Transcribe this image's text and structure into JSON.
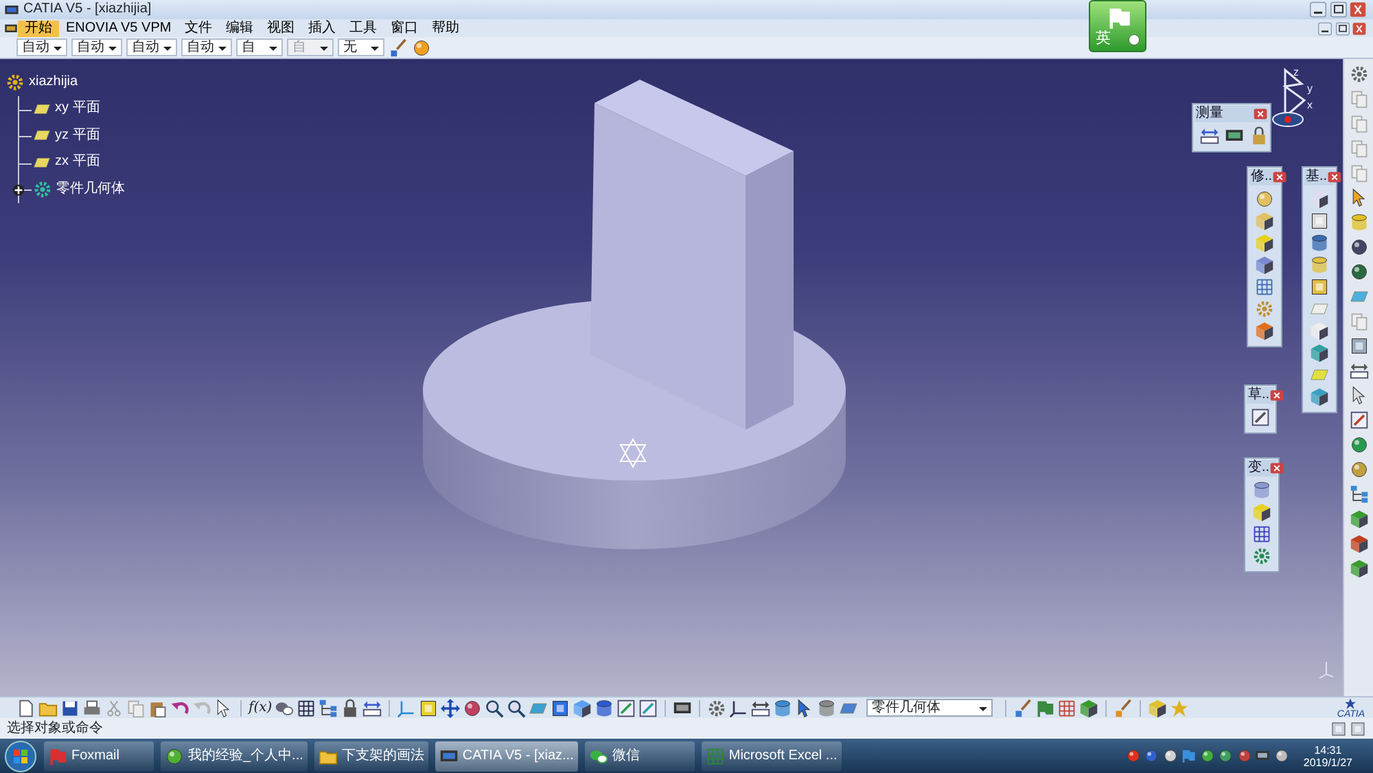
{
  "window": {
    "title": "CATIA V5 - [xiazhijia]"
  },
  "menu": {
    "items": [
      {
        "label": "开始",
        "selected": true
      },
      {
        "label": "ENOVIA V5 VPM",
        "selected": false
      },
      {
        "label": "文件",
        "selected": false
      },
      {
        "label": "编辑",
        "selected": false
      },
      {
        "label": "视图",
        "selected": false
      },
      {
        "label": "插入",
        "selected": false
      },
      {
        "label": "工具",
        "selected": false
      },
      {
        "label": "窗口",
        "selected": false
      },
      {
        "label": "帮助",
        "selected": false
      }
    ]
  },
  "toolbar": {
    "dropdowns": [
      {
        "value": "自动",
        "disabled": false
      },
      {
        "value": "自动",
        "disabled": false
      },
      {
        "value": "自动",
        "disabled": false
      },
      {
        "value": "自动",
        "disabled": false
      },
      {
        "value": "自",
        "disabled": false
      },
      {
        "value": "自",
        "disabled": true
      },
      {
        "value": "无",
        "disabled": false
      }
    ]
  },
  "ime": {
    "label": "英"
  },
  "tree": {
    "label": "xiazhijia",
    "children": [
      {
        "kind": "plane",
        "label": "xy 平面"
      },
      {
        "kind": "plane",
        "label": "yz 平面"
      },
      {
        "kind": "plane",
        "label": "zx 平面"
      },
      {
        "kind": "body",
        "label": "零件几何体",
        "expanded": false
      }
    ]
  },
  "compass": {
    "axes": [
      "z",
      "y",
      "x"
    ]
  },
  "floating_toolbars": [
    {
      "title": "测量"
    },
    {
      "title": "修.."
    },
    {
      "title": "基.."
    },
    {
      "title": "草.."
    },
    {
      "title": "变.."
    }
  ],
  "bottom_toolbar": {
    "formula": "f(x)",
    "body_dropdown": "零件几何体",
    "logo": "CATIA"
  },
  "status_bar": {
    "prompt": "选择对象或命令"
  },
  "taskbar": {
    "items": [
      {
        "kind": "foxmail",
        "label": "Foxmail",
        "selected": false
      },
      {
        "kind": "browser",
        "label": "我的经验_个人中...",
        "selected": false
      },
      {
        "kind": "folder",
        "label": "下支架的画法",
        "selected": false
      },
      {
        "kind": "catia",
        "label": "CATIA V5 - [xiaz...",
        "selected": true
      },
      {
        "kind": "chat",
        "label": "微信",
        "selected": false
      },
      {
        "kind": "spreadsheet",
        "label": "Microsoft Excel ...",
        "selected": false
      }
    ],
    "clock": {
      "time": "14:31",
      "date": "2019/1/27"
    }
  }
}
